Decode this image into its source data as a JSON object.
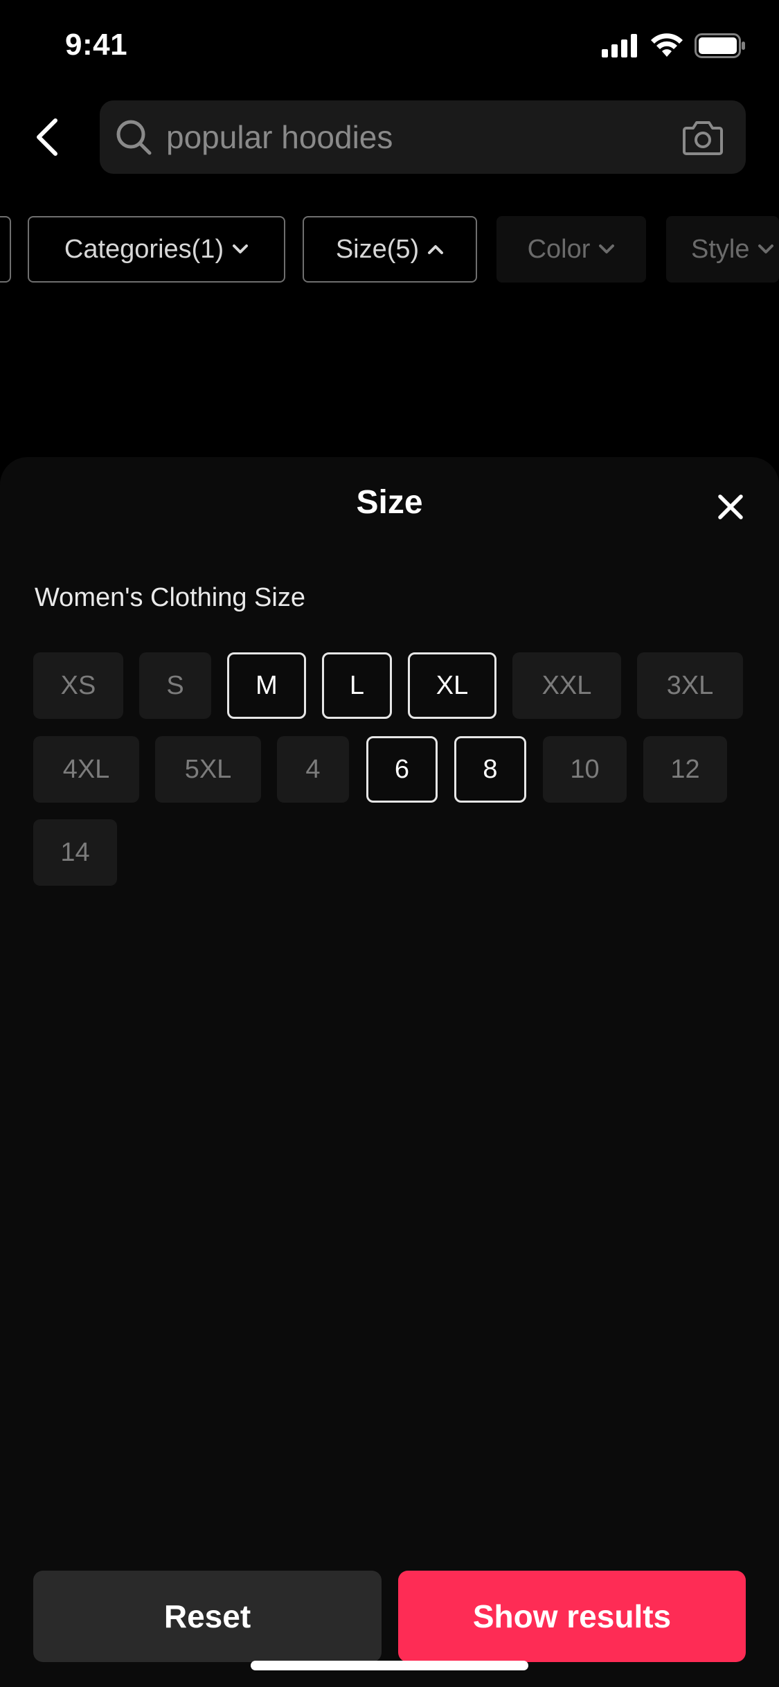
{
  "status_bar": {
    "time": "9:41"
  },
  "search": {
    "query": "popular hoodies"
  },
  "filters": [
    {
      "label": "Categories(1)",
      "state": "outline",
      "chevron": "down"
    },
    {
      "label": "Size(5)",
      "state": "outline",
      "chevron": "up"
    },
    {
      "label": "Color",
      "state": "muted",
      "chevron": "down"
    },
    {
      "label": "Style",
      "state": "muted",
      "chevron": "down"
    }
  ],
  "sheet": {
    "title": "Size",
    "section_label": "Women's Clothing Size",
    "sizes": [
      {
        "label": "XS",
        "selected": false
      },
      {
        "label": "S",
        "selected": false
      },
      {
        "label": "M",
        "selected": true
      },
      {
        "label": "L",
        "selected": true
      },
      {
        "label": "XL",
        "selected": true
      },
      {
        "label": "XXL",
        "selected": false
      },
      {
        "label": "3XL",
        "selected": false
      },
      {
        "label": "4XL",
        "selected": false
      },
      {
        "label": "5XL",
        "selected": false
      },
      {
        "label": "4",
        "selected": false
      },
      {
        "label": "6",
        "selected": true
      },
      {
        "label": "8",
        "selected": true
      },
      {
        "label": "10",
        "selected": false
      },
      {
        "label": "12",
        "selected": false
      },
      {
        "label": "14",
        "selected": false
      }
    ]
  },
  "footer": {
    "reset_label": "Reset",
    "show_label": "Show results"
  },
  "colors": {
    "accent": "#fe2c55",
    "background": "#000000",
    "sheet": "#0b0b0b",
    "chip": "#1a1a1a"
  },
  "icons": [
    "back-arrow-icon",
    "search-icon",
    "camera-icon",
    "chevron-down-icon",
    "chevron-up-icon",
    "close-icon",
    "signal-icon",
    "wifi-icon",
    "battery-icon"
  ]
}
